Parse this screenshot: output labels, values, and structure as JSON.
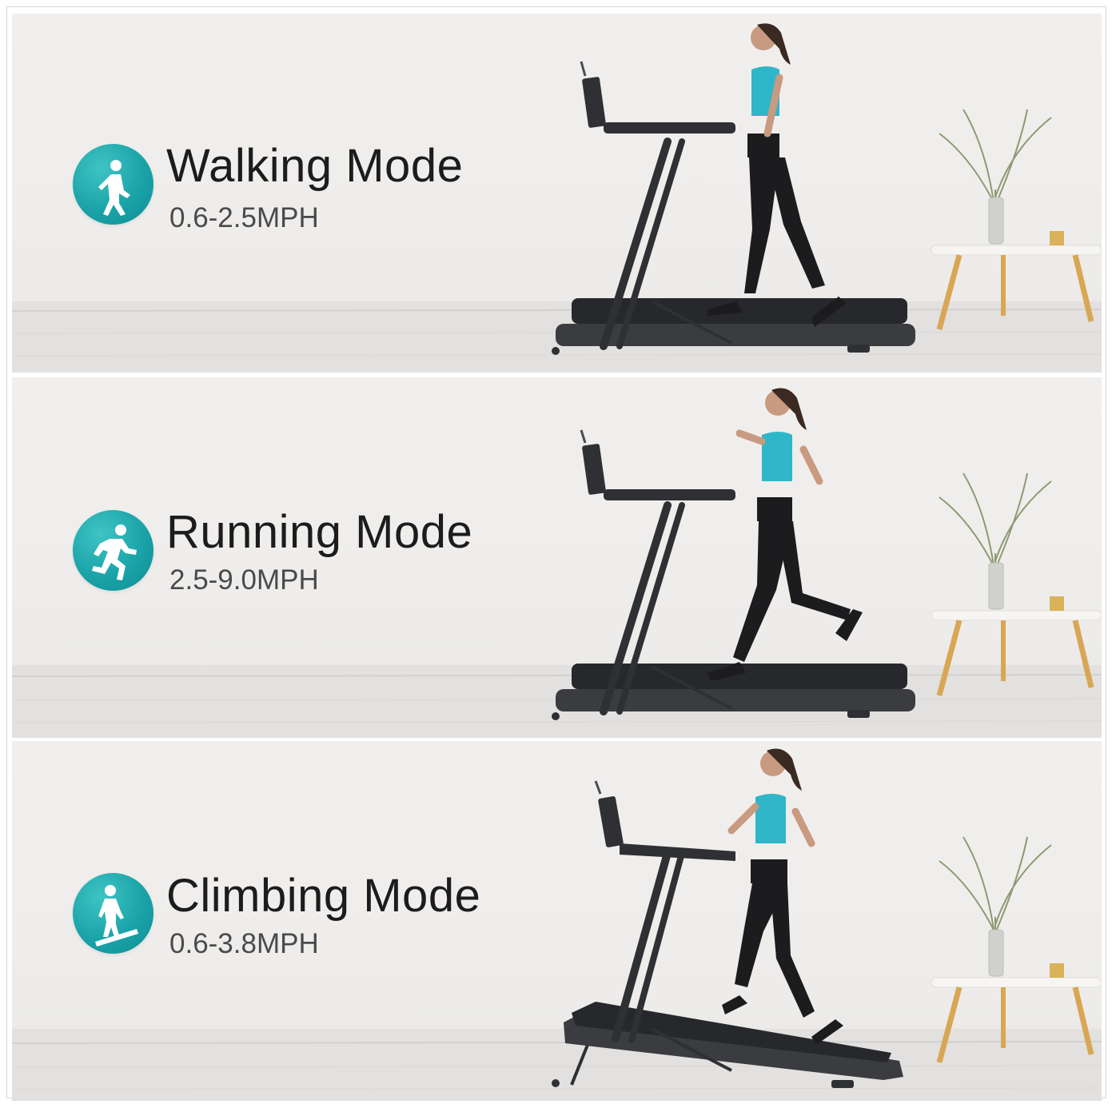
{
  "modes": [
    {
      "title": "Walking Mode",
      "speed": "0.6-2.5MPH",
      "icon": "walking-person-icon",
      "accent": "#1aa3a8"
    },
    {
      "title": "Running Mode",
      "speed": "2.5-9.0MPH",
      "icon": "running-person-icon",
      "accent": "#1aa3a8"
    },
    {
      "title": "Climbing Mode",
      "speed": "0.6-3.8MPH",
      "icon": "climbing-person-icon",
      "accent": "#1aa3a8"
    }
  ]
}
